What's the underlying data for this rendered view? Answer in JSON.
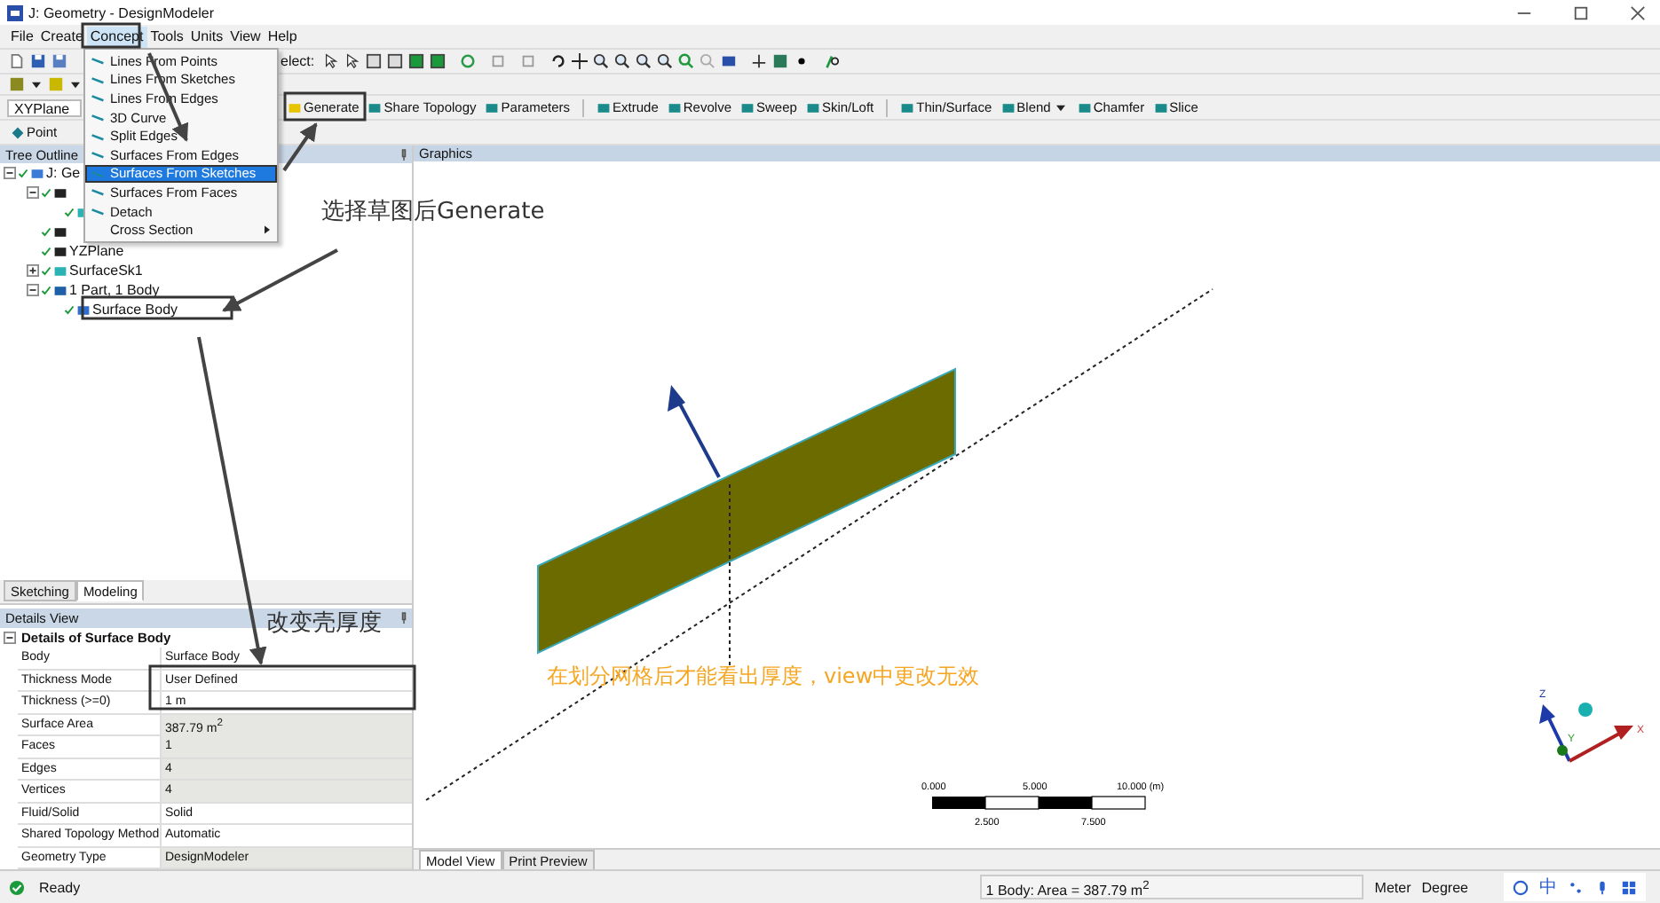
{
  "window": {
    "title": "J: Geometry - DesignModeler"
  },
  "menu_bar": [
    {
      "label": "File",
      "selected": false
    },
    {
      "label": "Create",
      "selected": false
    },
    {
      "label": "Concept",
      "selected": true
    },
    {
      "label": "Tools",
      "selected": false
    },
    {
      "label": "Units",
      "selected": false
    },
    {
      "label": "View",
      "selected": false
    },
    {
      "label": "Help",
      "selected": false
    }
  ],
  "concept_menu": [
    {
      "label": "Lines From Points",
      "selected": false,
      "has_icon": true,
      "submenu": false
    },
    {
      "label": "Lines From Sketches",
      "selected": false,
      "has_icon": true,
      "submenu": false
    },
    {
      "label": "Lines From Edges",
      "selected": false,
      "has_icon": true,
      "submenu": false
    },
    {
      "label": "3D Curve",
      "selected": false,
      "has_icon": true,
      "submenu": false
    },
    {
      "label": "Split Edges",
      "selected": false,
      "has_icon": true,
      "submenu": false
    },
    {
      "label": "Surfaces From Edges",
      "selected": false,
      "has_icon": true,
      "submenu": false
    },
    {
      "label": "Surfaces From Sketches",
      "selected": true,
      "has_icon": true,
      "submenu": false
    },
    {
      "label": "Surfaces From Faces",
      "selected": false,
      "has_icon": true,
      "submenu": false
    },
    {
      "label": "Detach",
      "selected": false,
      "has_icon": true,
      "submenu": false
    },
    {
      "label": "Cross Section",
      "selected": false,
      "has_icon": false,
      "submenu": true
    }
  ],
  "select_label": "elect:",
  "plane_dropdown": {
    "value": "XYPlane"
  },
  "feature_toolbar": [
    {
      "label": "Generate",
      "separator_before": false,
      "has_menu": false
    },
    {
      "label": "Share Topology",
      "separator_before": false,
      "has_menu": false
    },
    {
      "label": "Parameters",
      "separator_before": false,
      "has_menu": false
    },
    {
      "label": "Extrude",
      "separator_before": true,
      "has_menu": false
    },
    {
      "label": "Revolve",
      "separator_before": false,
      "has_menu": false
    },
    {
      "label": "Sweep",
      "separator_before": false,
      "has_menu": false
    },
    {
      "label": "Skin/Loft",
      "separator_before": false,
      "has_menu": false
    },
    {
      "label": "Thin/Surface",
      "separator_before": true,
      "has_menu": false
    },
    {
      "label": "Blend",
      "separator_before": false,
      "has_menu": true
    },
    {
      "label": "Chamfer",
      "separator_before": false,
      "has_menu": false
    },
    {
      "label": "Slice",
      "separator_before": false,
      "has_menu": false
    }
  ],
  "point_tool": {
    "label": "Point"
  },
  "tree_outline": {
    "title": "Tree Outline",
    "items": [
      {
        "label": "J: Ge",
        "kind": "root",
        "expanded": true,
        "children": [
          {
            "kind": "plane",
            "expanded": true,
            "children": [
              {
                "kind": "sketch"
              }
            ]
          },
          {
            "kind": "plane"
          },
          {
            "label": "YZPlane",
            "kind": "plane"
          },
          {
            "label": "SurfaceSk1",
            "kind": "sketch",
            "expanded": false
          },
          {
            "label": "1 Part, 1 Body",
            "kind": "part",
            "expanded": true,
            "children": [
              {
                "label": "Surface Body",
                "kind": "body"
              }
            ]
          }
        ]
      }
    ]
  },
  "left_tabs": [
    {
      "label": "Sketching",
      "selected": false
    },
    {
      "label": "Modeling",
      "selected": true
    }
  ],
  "details_view": {
    "title": "Details View",
    "group": "Details of Surface Body",
    "rows": [
      {
        "label": "Body",
        "value": "Surface Body",
        "editable": true
      },
      {
        "label": "Thickness Mode",
        "value": "User Defined",
        "editable": true
      },
      {
        "label": "Thickness (>=0)",
        "value": "1 m",
        "editable": true
      },
      {
        "label": "Surface Area",
        "value": "387.79 m$^{2}$",
        "editable": false
      },
      {
        "label": "Faces",
        "value": "1",
        "editable": false
      },
      {
        "label": "Edges",
        "value": "4",
        "editable": false
      },
      {
        "label": "Vertices",
        "value": "4",
        "editable": false
      },
      {
        "label": "Fluid/Solid",
        "value": "Solid",
        "editable": true
      },
      {
        "label": "Shared Topology Method",
        "value": "Automatic",
        "editable": true
      },
      {
        "label": "Geometry Type",
        "value": "DesignModeler",
        "editable": false
      }
    ]
  },
  "graphics": {
    "title": "Graphics",
    "scale_bar": {
      "top_labels": [
        "0.000",
        "5.000",
        "10.000 (m)"
      ],
      "bottom_labels": [
        "2.500",
        "7.500"
      ]
    },
    "axes": {
      "z": "Z",
      "x": "X",
      "y": "Y"
    },
    "tabs": [
      {
        "label": "Model View",
        "selected": true
      },
      {
        "label": "Print Preview",
        "selected": false
      }
    ]
  },
  "annotations": [
    {
      "text": "选择草图后Generate",
      "kind": "label"
    },
    {
      "text": "改变壳厚度",
      "kind": "label"
    },
    {
      "text": "在划分网格后才能看出厚度，view中更改无效",
      "kind": "note"
    }
  ],
  "status_bar": {
    "state": "Ready",
    "selection": "1 Body: Area = 387.79 m$^{2}$",
    "units": [
      "Meter",
      "Degree"
    ],
    "ime": "中"
  }
}
